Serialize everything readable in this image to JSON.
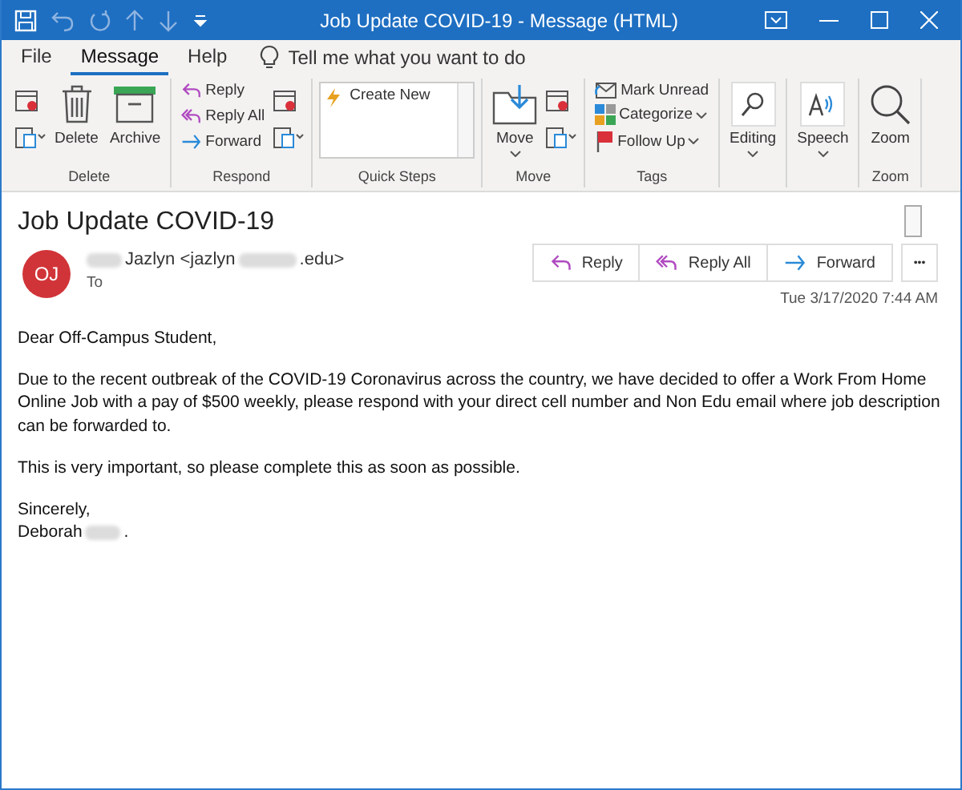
{
  "window": {
    "title": "Job Update COVID-19  -  Message (HTML)"
  },
  "menu_tabs": [
    {
      "label": "File",
      "selected": false
    },
    {
      "label": "Message",
      "selected": true
    },
    {
      "label": "Help",
      "selected": false
    }
  ],
  "tell_me": {
    "placeholder": "Tell me what you want to do"
  },
  "ribbon": {
    "groups": [
      {
        "label": "Delete",
        "items": [
          {
            "kind": "icon-pair"
          },
          {
            "kind": "large",
            "label": "Delete"
          },
          {
            "kind": "large",
            "label": "Archive"
          }
        ]
      },
      {
        "label": "Respond",
        "items": [
          {
            "kind": "small-stack",
            "entries": [
              {
                "label": "Reply"
              },
              {
                "label": "Reply All"
              },
              {
                "label": "Forward"
              }
            ]
          },
          {
            "kind": "icon-pair"
          }
        ]
      },
      {
        "label": "Quick Steps",
        "items": [
          {
            "kind": "gallery",
            "label": "Create New"
          }
        ]
      },
      {
        "label": "Move",
        "items": [
          {
            "kind": "large",
            "label": "Move"
          },
          {
            "kind": "icon-pair"
          }
        ]
      },
      {
        "label": "Tags",
        "items": [
          {
            "kind": "small-stack",
            "entries": [
              {
                "label": "Mark Unread"
              },
              {
                "label": "Categorize"
              },
              {
                "label": "Follow Up"
              }
            ]
          }
        ]
      },
      {
        "items": [
          {
            "kind": "large",
            "label": "Editing"
          }
        ]
      },
      {
        "items": [
          {
            "kind": "large",
            "label": "Speech"
          }
        ]
      },
      {
        "label": "Zoom",
        "items": [
          {
            "kind": "large",
            "label": "Zoom"
          }
        ]
      }
    ]
  },
  "message": {
    "subject": "Job Update COVID-19",
    "avatar": "OJ",
    "sender": {
      "name": "Jazlyn <jazlyn",
      "domain_end": ".edu>"
    },
    "to_label": "To",
    "actions": [
      {
        "label": "Reply"
      },
      {
        "label": "Reply All"
      },
      {
        "label": "Forward"
      }
    ],
    "more": "•••",
    "date": "Tue 3/17/2020 7:44 AM",
    "body": [
      "Dear Off-Campus Student,",
      "Due to the recent outbreak of the COVID-19 Coronavirus across the country, we have decided to offer a Work From Home Online Job with a pay of $500 weekly, please respond with your direct cell number and Non Edu email where job description can be forwarded to.",
      "This is very important, so please complete this as soon as possible."
    ],
    "closing": "Sincerely,",
    "signature": {
      "first_name": "Deborah",
      "end": "."
    }
  }
}
